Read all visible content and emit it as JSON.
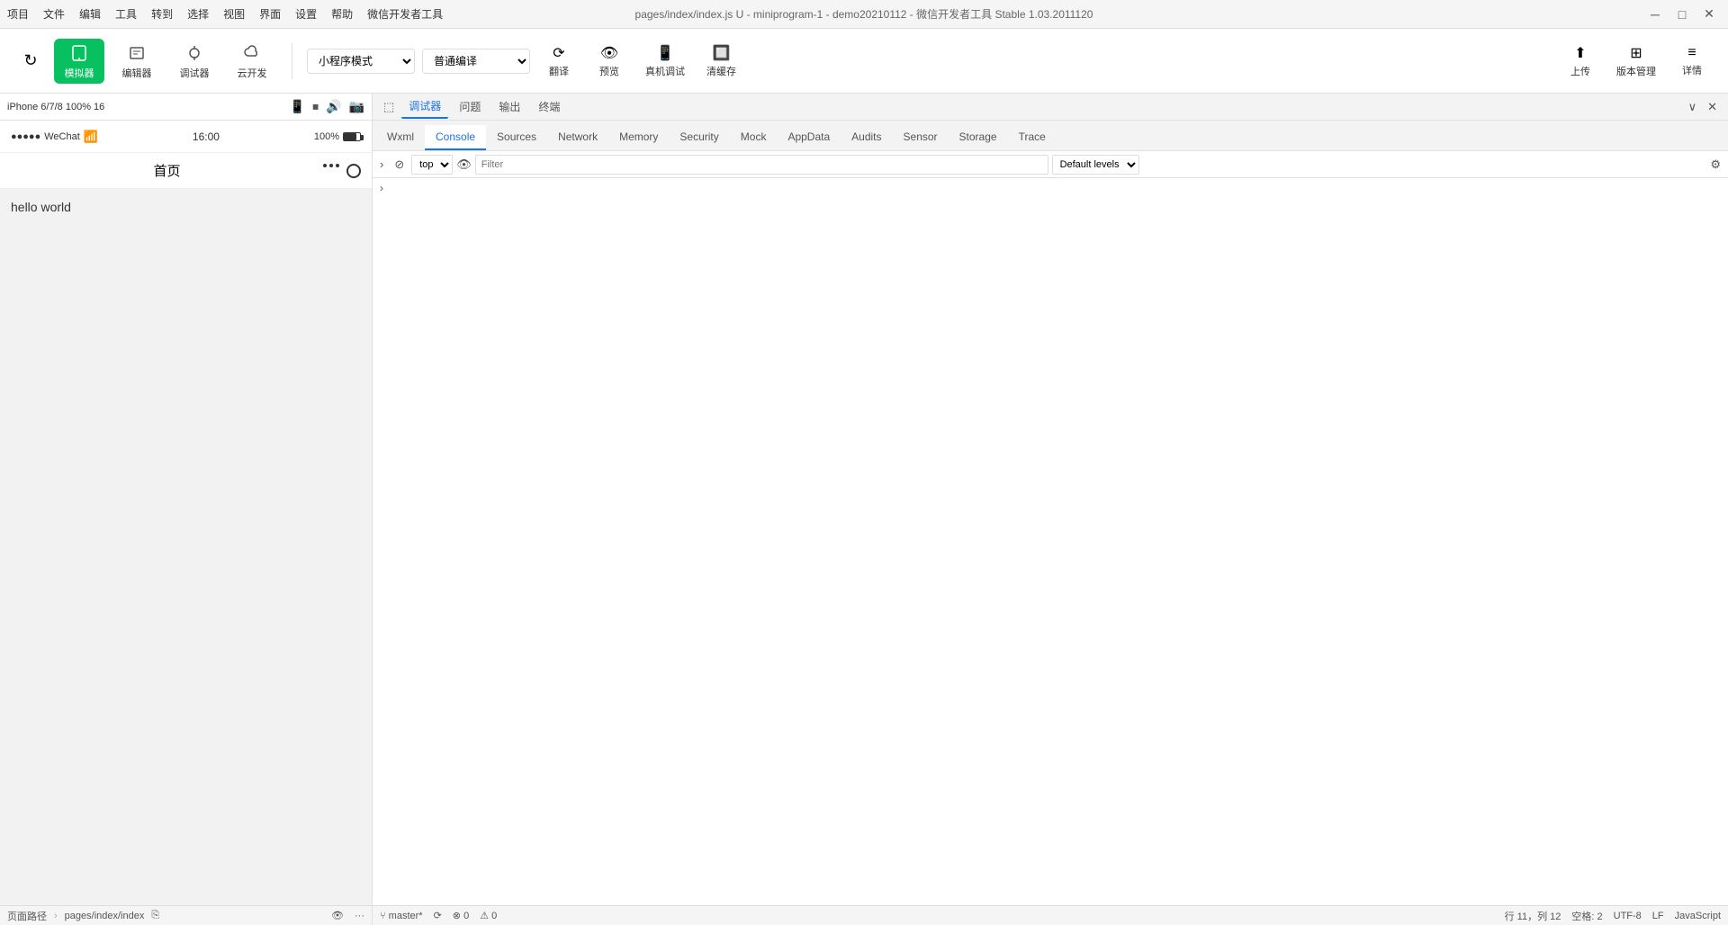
{
  "window": {
    "title": "pages/index/index.js U - miniprogram-1 - demo20210112 - 微信开发者工具 Stable 1.03.2011120",
    "minimize": "minimize",
    "maximize": "maximize",
    "close": "close"
  },
  "menu": {
    "items": [
      "项目",
      "文件",
      "编辑",
      "工具",
      "转到",
      "选择",
      "视图",
      "界面",
      "设置",
      "帮助",
      "微信开发者工具"
    ]
  },
  "toolbar": {
    "simulator_label": "模拟器",
    "editor_label": "编辑器",
    "debugger_label": "调试器",
    "cloud_label": "云开发",
    "mode_label": "小程序模式",
    "compile_label": "普通编译",
    "translate_label": "翻译",
    "preview_label": "预览",
    "realtest_label": "真机调试",
    "clearcache_label": "清缓存",
    "upload_label": "上传",
    "version_label": "版本管理",
    "detail_label": "详情"
  },
  "simulator": {
    "device": "iPhone 6/7/8",
    "scale": "100%",
    "font_size": "16",
    "status_signal": "●●●●●",
    "status_app": "WeChat",
    "status_wifi": "WiFi",
    "status_time": "16:00",
    "status_battery": "100%",
    "nav_title": "首页",
    "content": "hello world"
  },
  "devtools": {
    "topbar_tabs": [
      "调试器",
      "问题",
      "输出",
      "终端"
    ],
    "tabs": [
      "Wxml",
      "Console",
      "Sources",
      "Network",
      "Memory",
      "Security",
      "Mock",
      "AppData",
      "Audits",
      "Sensor",
      "Storage",
      "Trace"
    ],
    "active_tab": "Console",
    "console": {
      "context": "top",
      "filter_placeholder": "Filter",
      "levels": "Default levels"
    }
  },
  "status_bar": {
    "path_label": "页面路径",
    "page_path": "pages/index/index",
    "git_branch": "master*",
    "errors": "0",
    "warnings": "0",
    "line": "行 11，列 12",
    "spaces": "空格: 2",
    "encoding": "UTF-8",
    "line_ending": "LF",
    "language": "JavaScript"
  }
}
